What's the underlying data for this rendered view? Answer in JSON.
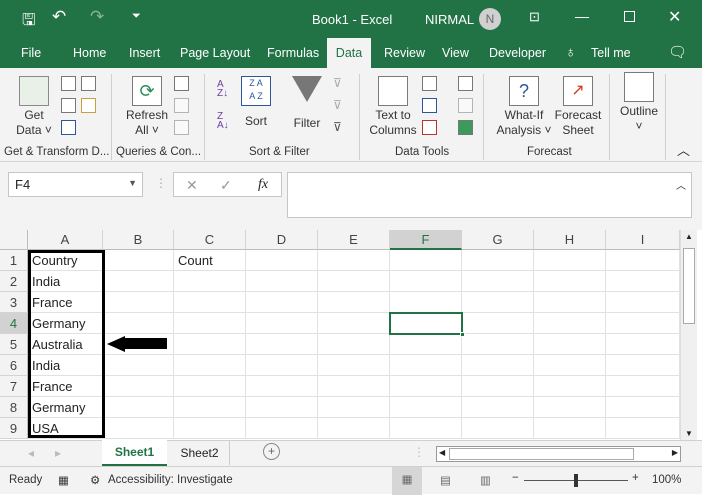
{
  "title": {
    "doc": "Book1  -  Excel",
    "user": "NIRMAL",
    "avatar": "N"
  },
  "tabs": [
    "File",
    "Home",
    "Insert",
    "Page Layout",
    "Formulas",
    "Data",
    "Review",
    "View",
    "Developer",
    "Tell me"
  ],
  "ribbon": {
    "get_data": "Get",
    "get_data2": "Data ˅",
    "refresh": "Refresh",
    "refresh2": "All ˅",
    "sort": "Sort",
    "filter": "Filter",
    "text_to": "Text to",
    "columns": "Columns",
    "whatif": "What-If",
    "analysis": "Analysis ˅",
    "forecast": "Forecast",
    "sheet": "Sheet",
    "outline": "Outline",
    "groups": [
      "Get & Transform D...",
      "Queries & Con...",
      "Sort & Filter",
      "Data Tools",
      "Forecast"
    ]
  },
  "formula_bar": {
    "name_box": "F4",
    "fx": "fx",
    "value": ""
  },
  "columns": [
    "A",
    "B",
    "C",
    "D",
    "E",
    "F",
    "G",
    "H",
    "I"
  ],
  "rows": [
    "1",
    "2",
    "3",
    "4",
    "5",
    "6",
    "7",
    "8",
    "9"
  ],
  "cells": {
    "A": [
      "Country",
      "India",
      "France",
      "Germany",
      "Australia",
      "India",
      "France",
      "Germany",
      "USA"
    ],
    "C1": "Count"
  },
  "selected_cell": "F4",
  "sheets": [
    "Sheet1",
    "Sheet2"
  ],
  "status": {
    "ready": "Ready",
    "accessibility": "Accessibility: Investigate",
    "zoom": "100%"
  },
  "colors": {
    "accent": "#217346"
  }
}
